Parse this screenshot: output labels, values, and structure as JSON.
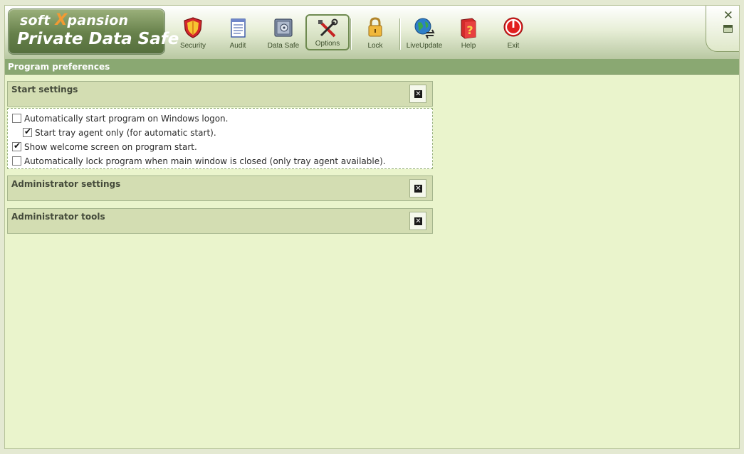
{
  "logo": {
    "brand_prefix": "soft ",
    "brand_x": "X",
    "brand_suffix": "pansion",
    "product": "Private Data Safe"
  },
  "toolbar": {
    "security": "Security",
    "audit": "Audit",
    "datasafe": "Data Safe",
    "options": "Options",
    "lock": "Lock",
    "liveupdate": "LiveUpdate",
    "help": "Help",
    "exit": "Exit"
  },
  "window_controls": {
    "close": "✕"
  },
  "page": {
    "title": "Program preferences"
  },
  "panels": {
    "start": {
      "title": "Start settings",
      "options": [
        {
          "label": "Automatically start program on Windows logon.",
          "checked": false
        },
        {
          "label": "Start tray agent only (for automatic start).",
          "checked": true
        },
        {
          "label": "Show welcome screen on program start.",
          "checked": true
        },
        {
          "label": "Automatically lock program when main window is closed (only tray agent available).",
          "checked": false
        }
      ]
    },
    "admin_settings": {
      "title": "Administrator settings"
    },
    "admin_tools": {
      "title": "Administrator tools"
    }
  },
  "colors": {
    "accent": "#8aa872",
    "panel": "#d3ddb2",
    "background": "#eaf4cc"
  }
}
